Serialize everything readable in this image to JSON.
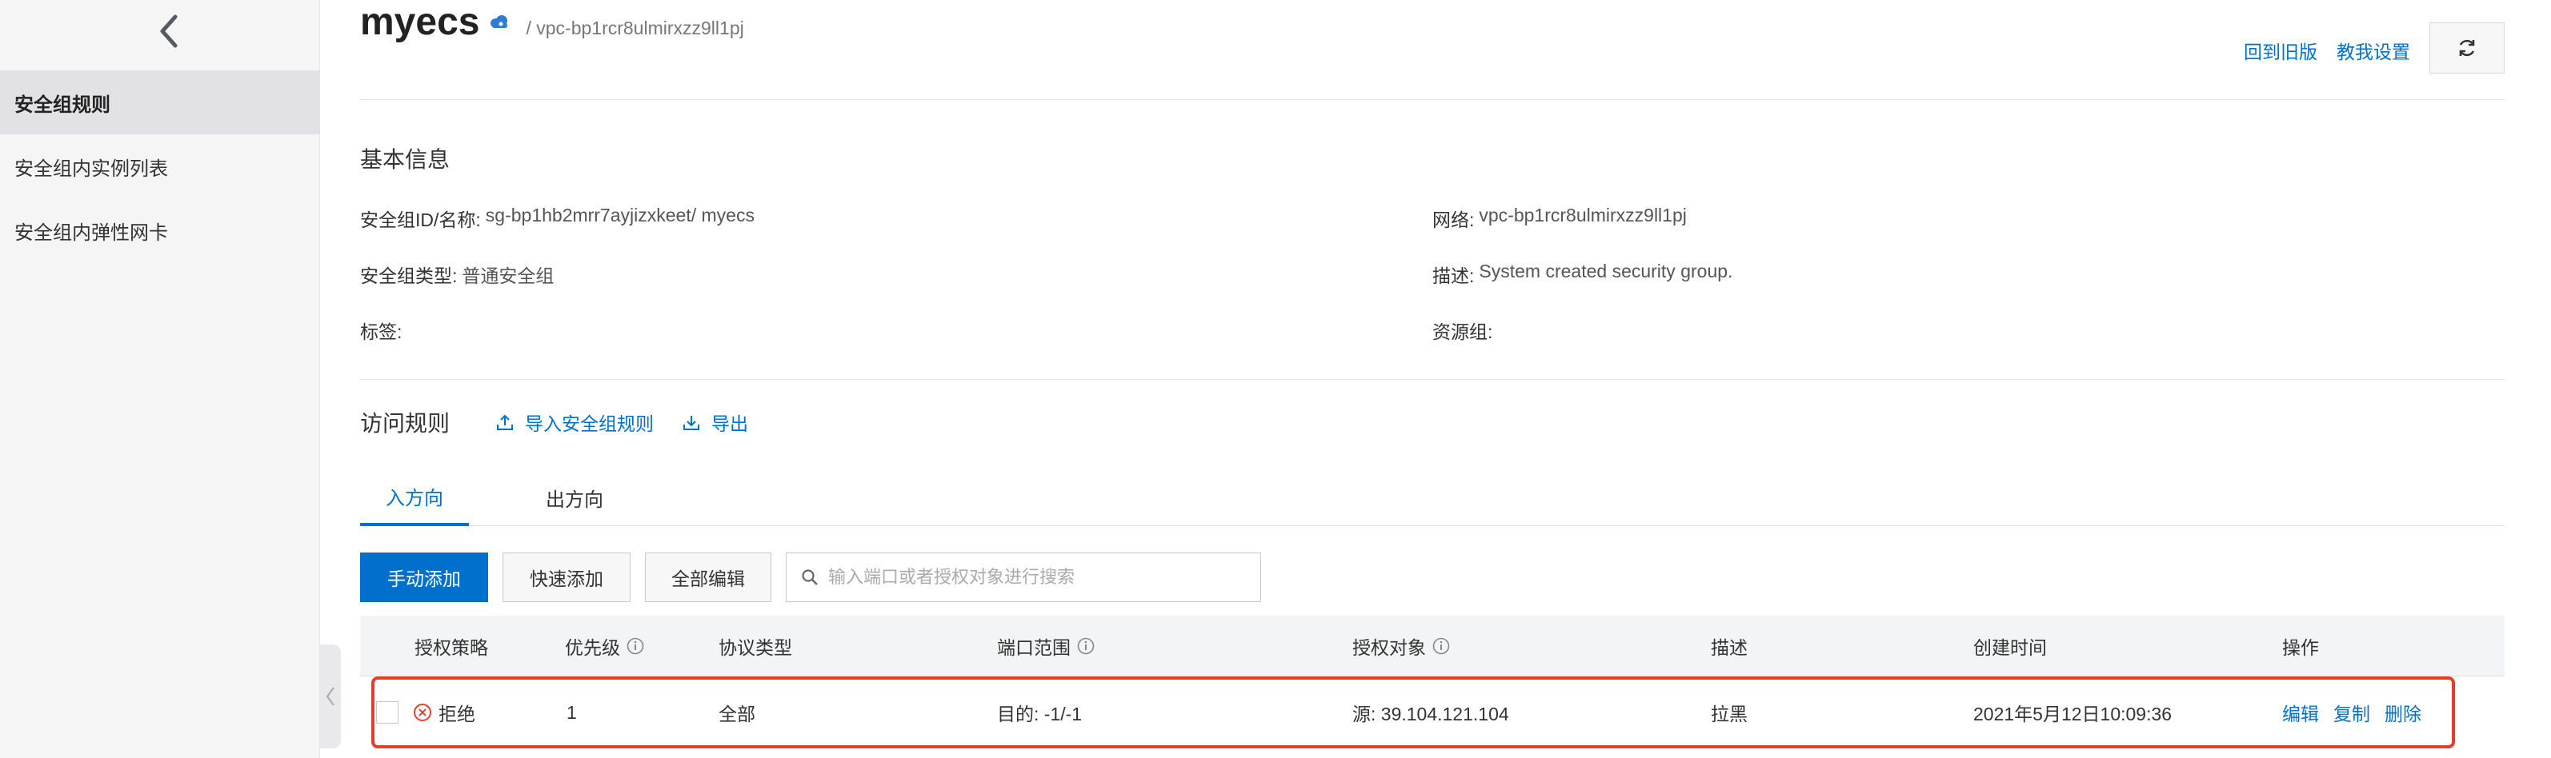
{
  "sidebar": {
    "items": [
      {
        "label": "安全组规则"
      },
      {
        "label": "安全组内实例列表"
      },
      {
        "label": "安全组内弹性网卡"
      }
    ]
  },
  "header": {
    "title": "myecs",
    "breadcrumb": "/ vpc-bp1rcr8ulmirxzz9ll1pj",
    "link_old": "回到旧版",
    "link_tutorial": "教我设置"
  },
  "basic_info": {
    "section_title": "基本信息",
    "sg_id_label": "安全组ID/名称:",
    "sg_id_value": "sg-bp1hb2mrr7ayjizxkeet/ myecs",
    "network_label": "网络:",
    "network_value": "vpc-bp1rcr8ulmirxzz9ll1pj",
    "sg_type_label": "安全组类型:",
    "sg_type_value": "普通安全组",
    "desc_label": "描述:",
    "desc_value": "System created security group.",
    "tag_label": "标签:",
    "resource_group_label": "资源组:"
  },
  "rules": {
    "section_title": "访问规则",
    "import_label": "导入安全组规则",
    "export_label": "导出",
    "tabs": [
      {
        "label": "入方向"
      },
      {
        "label": "出方向"
      }
    ],
    "buttons": {
      "manual_add": "手动添加",
      "quick_add": "快速添加",
      "edit_all": "全部编辑"
    },
    "search_placeholder": "输入端口或者授权对象进行搜索",
    "columns": {
      "policy": "授权策略",
      "priority": "优先级",
      "protocol": "协议类型",
      "port_range": "端口范围",
      "auth_object": "授权对象",
      "description": "描述",
      "created": "创建时间",
      "actions": "操作"
    },
    "rows": [
      {
        "policy": "拒绝",
        "priority": "1",
        "protocol": "全部",
        "port_range": "目的: -1/-1",
        "auth_object": "源: 39.104.121.104",
        "description": "拉黑",
        "created": "2021年5月12日10:09:36",
        "action_edit": "编辑",
        "action_copy": "复制",
        "action_delete": "删除"
      }
    ]
  },
  "colors": {
    "accent": "#0070cc",
    "highlight": "#e0402a",
    "deny": "#e0402a"
  }
}
